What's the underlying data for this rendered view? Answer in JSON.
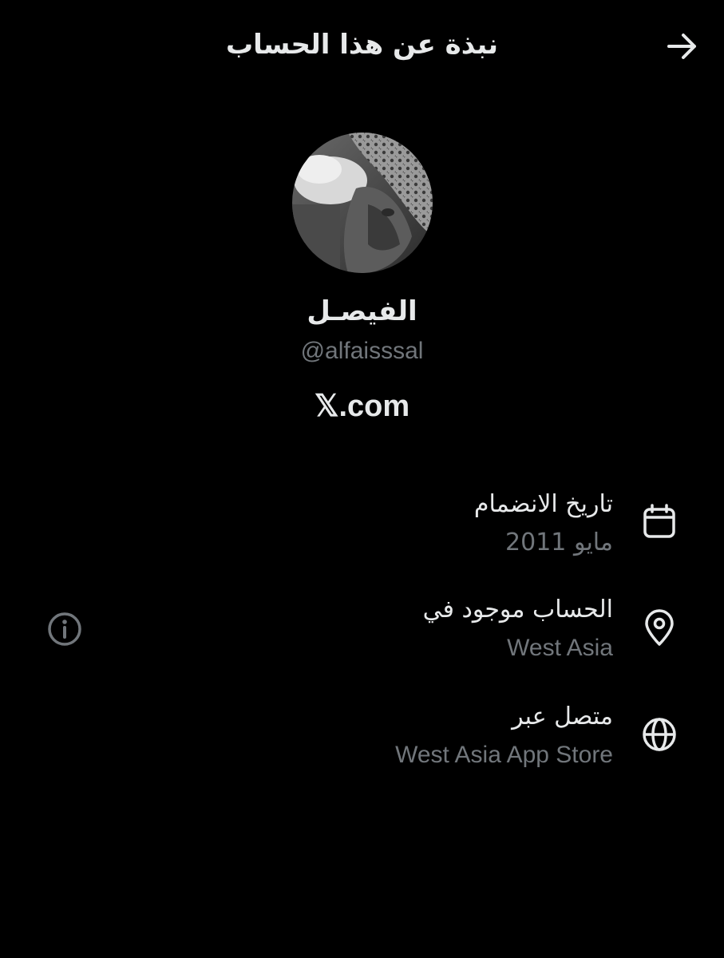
{
  "header": {
    "title": "نبذة عن هذا الحساب",
    "back_icon": "arrow-right-icon"
  },
  "profile": {
    "display_name": "الفيصـل",
    "handle": "@alfaisssal",
    "site_link": "𝕏.com"
  },
  "details": [
    {
      "icon": "calendar-icon",
      "label": "تاريخ الانضمام",
      "value": "مايو 2011"
    },
    {
      "icon": "location-pin-icon",
      "label": "الحساب موجود في",
      "value": "West Asia"
    },
    {
      "icon": "globe-icon",
      "label": "متصل عبر",
      "value": "West Asia App Store"
    }
  ],
  "colors": {
    "background": "#000000",
    "primary_text": "#e7e9ea",
    "secondary_text": "#71767b"
  }
}
